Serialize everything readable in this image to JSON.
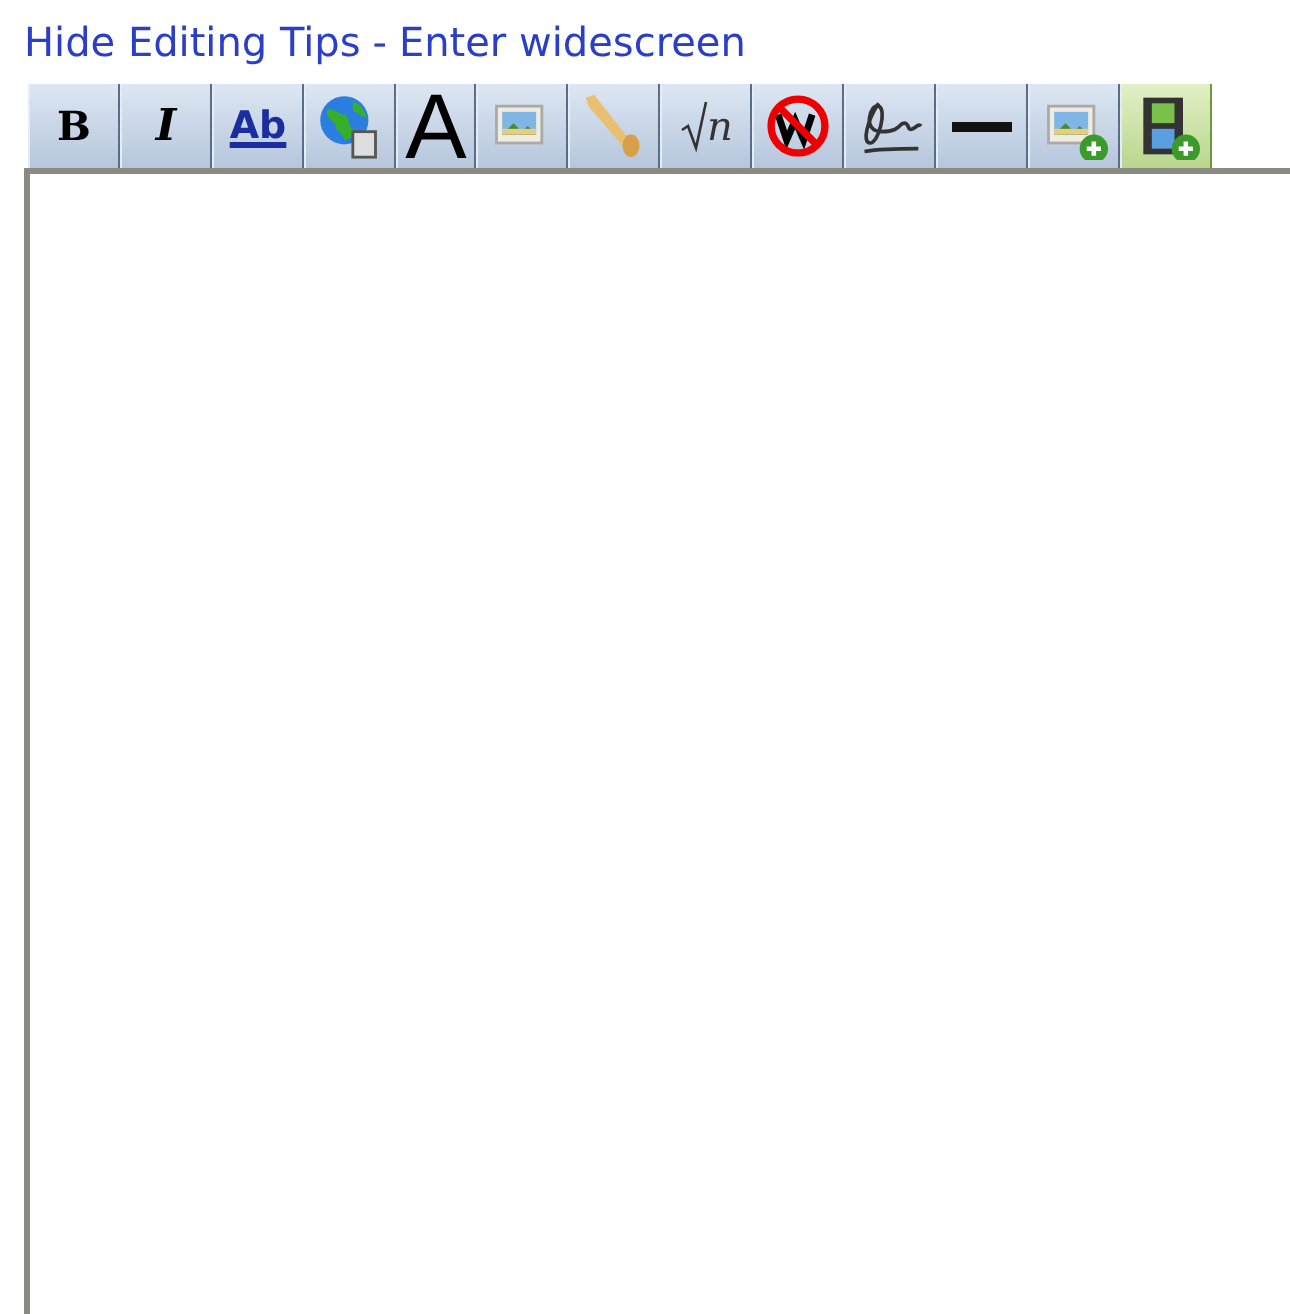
{
  "links": [
    {
      "label": "Hide Editing Tips"
    },
    {
      "label": "Enter widescreen"
    }
  ],
  "separator": "-",
  "toolbar": [
    {
      "kind": "bold",
      "label": "B",
      "highlighted": false
    },
    {
      "kind": "italic",
      "label": "I",
      "highlighted": false
    },
    {
      "kind": "underline",
      "label": "Ab",
      "highlighted": false
    },
    {
      "kind": "globe",
      "highlighted": false
    },
    {
      "kind": "headline",
      "label": "A",
      "highlighted": false
    },
    {
      "kind": "image",
      "highlighted": false
    },
    {
      "kind": "horn",
      "highlighted": false
    },
    {
      "kind": "math",
      "label": "n",
      "highlighted": false
    },
    {
      "kind": "nowiki",
      "highlighted": false
    },
    {
      "kind": "signature",
      "highlighted": false
    },
    {
      "kind": "line",
      "highlighted": false
    },
    {
      "kind": "add-image",
      "highlighted": false
    },
    {
      "kind": "add-video",
      "highlighted": true
    }
  ]
}
